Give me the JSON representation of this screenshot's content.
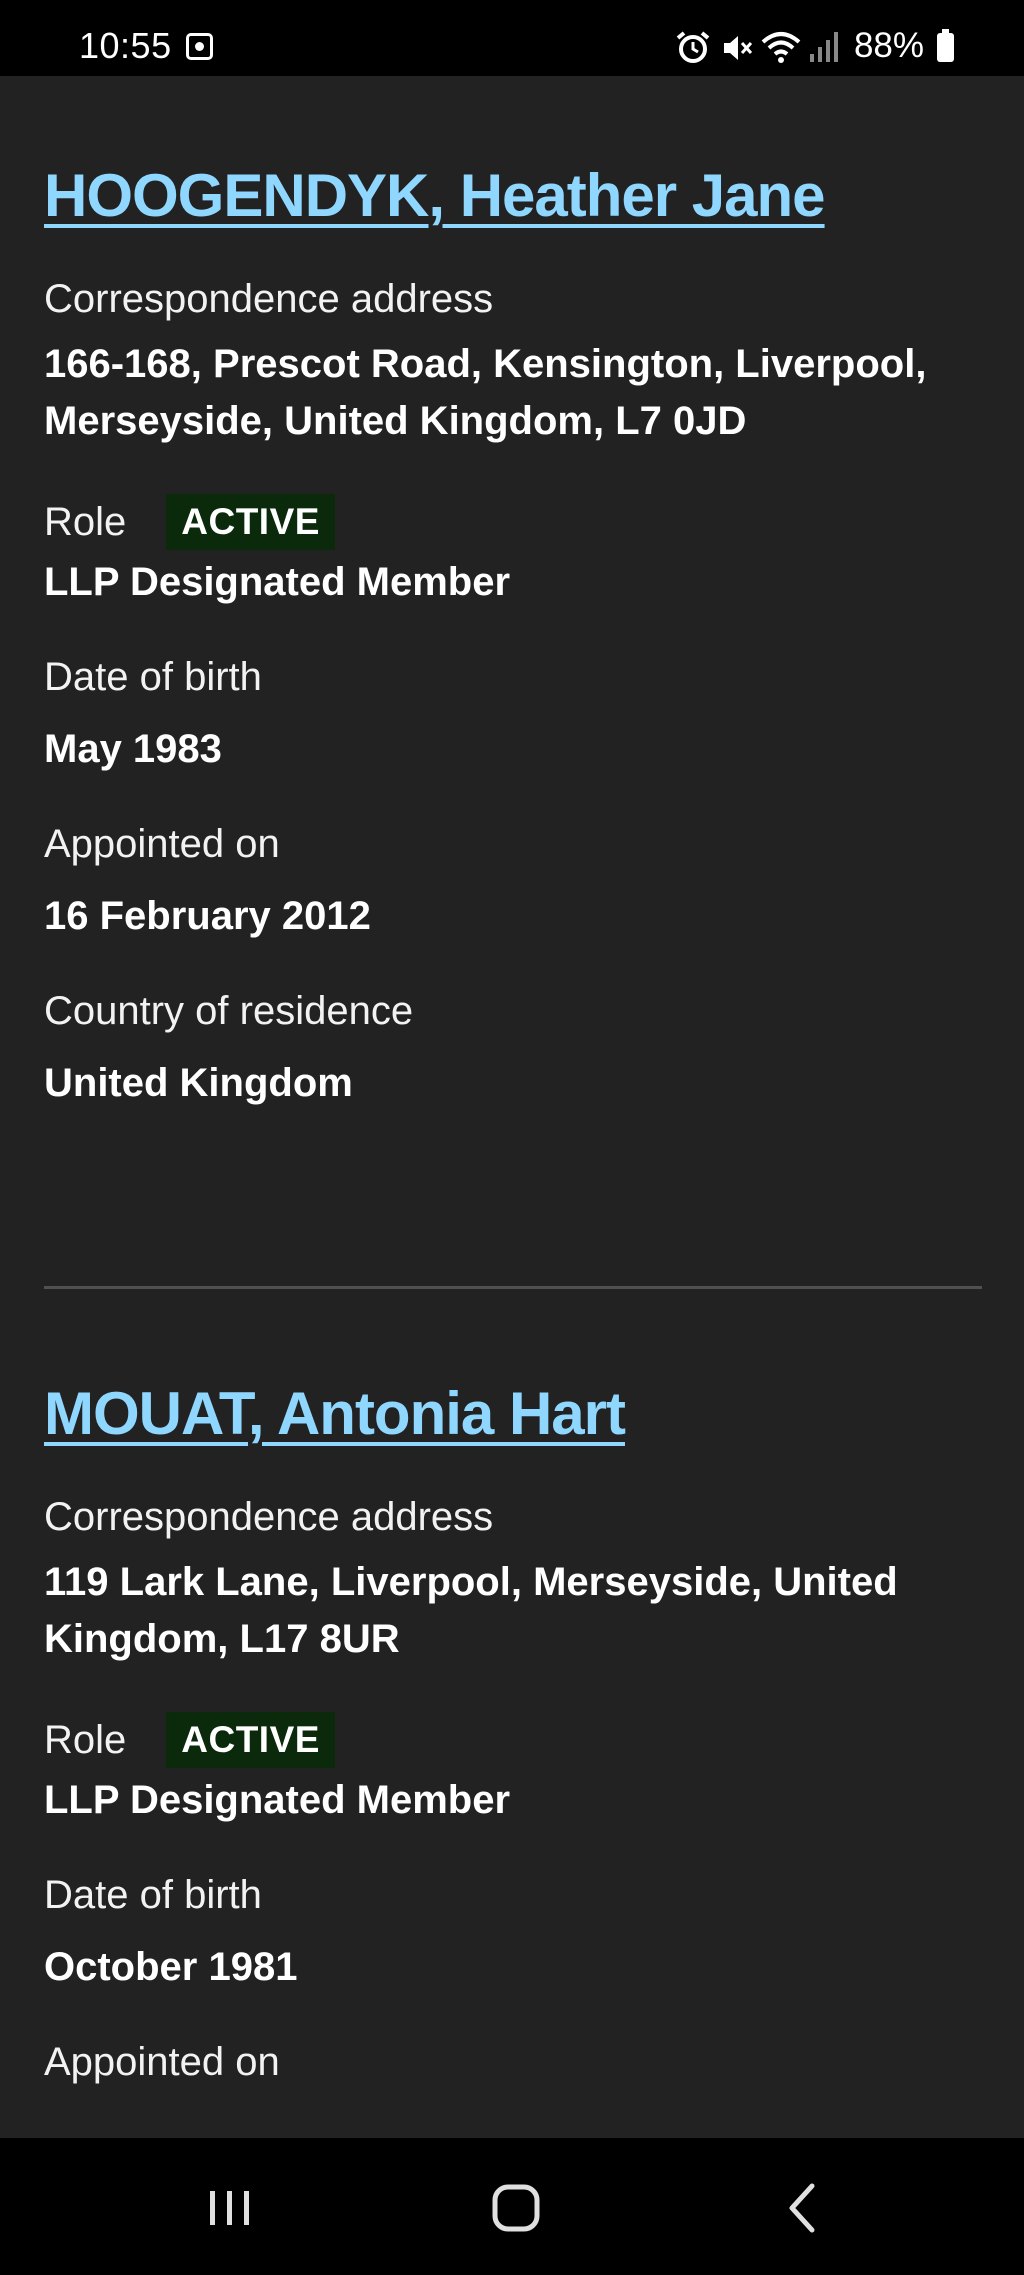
{
  "status_bar": {
    "time": "10:55",
    "battery": "88%",
    "icons": [
      "notification-icon",
      "alarm-icon",
      "mute-icon",
      "wifi-icon",
      "signal-icon",
      "battery-icon"
    ]
  },
  "officers": [
    {
      "name": "HOOGENDYK, Heather Jane",
      "address_label": "Correspondence address",
      "address_line1": "166-168, Prescot Road, Kensington, Liverpool,",
      "address_line2": "Merseyside, United Kingdom, L7 0JD",
      "role_label": "Role",
      "status": "ACTIVE",
      "role": "LLP Designated Member",
      "dob_label": "Date of birth",
      "dob": "May 1983",
      "appointed_label": "Appointed on",
      "appointed": "16 February 2012",
      "country_label": "Country of residence",
      "country": "United Kingdom"
    },
    {
      "name": "MOUAT, Antonia Hart",
      "address_label": "Correspondence address",
      "address_line1": "119 Lark Lane, Liverpool, Merseyside, United",
      "address_line2": "Kingdom, L17 8UR",
      "role_label": "Role",
      "status": "ACTIVE",
      "role": "LLP Designated Member",
      "dob_label": "Date of birth",
      "dob": "October 1981",
      "appointed_label": "Appointed on"
    }
  ],
  "nav_bar": {
    "icons": [
      "recent-apps-icon",
      "home-icon",
      "back-icon"
    ]
  },
  "colors": {
    "background": "#222222",
    "link": "#8fd7ff",
    "badge": "#0b2a0c",
    "divider": "#505050"
  }
}
